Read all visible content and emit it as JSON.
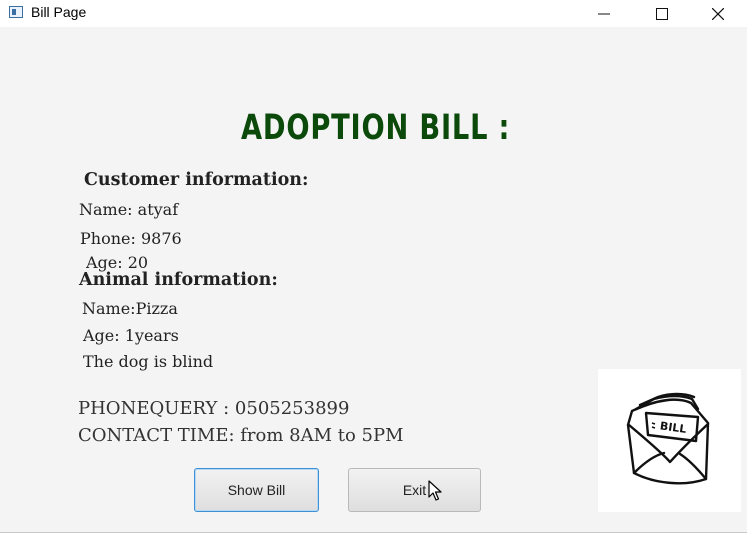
{
  "window": {
    "title": "Bill Page",
    "controls": [
      "minimize",
      "maximize",
      "close"
    ]
  },
  "heading": "ADOPTION BILL :",
  "customer": {
    "section_title": "Customer information:",
    "name": "Name: atyaf",
    "phone": "Phone: 9876",
    "age": "Age: 20"
  },
  "animal": {
    "section_title": "Animal information:",
    "name": "Name:Pizza",
    "age": "Age: 1years",
    "note": "The dog is blind"
  },
  "contact": {
    "phone_query": "PHONEQUERY : 0505253899",
    "contact_time": "CONTACT TIME: from 8AM to 5PM"
  },
  "buttons": {
    "show_bill": "Show Bill",
    "exit": "Exit"
  },
  "illustration": {
    "label": "BILL",
    "icon": "bill-envelope-sketch"
  },
  "colors": {
    "heading": "#0b4a0b",
    "focus_border": "#3d8fd6",
    "background": "#f4f4f4"
  }
}
